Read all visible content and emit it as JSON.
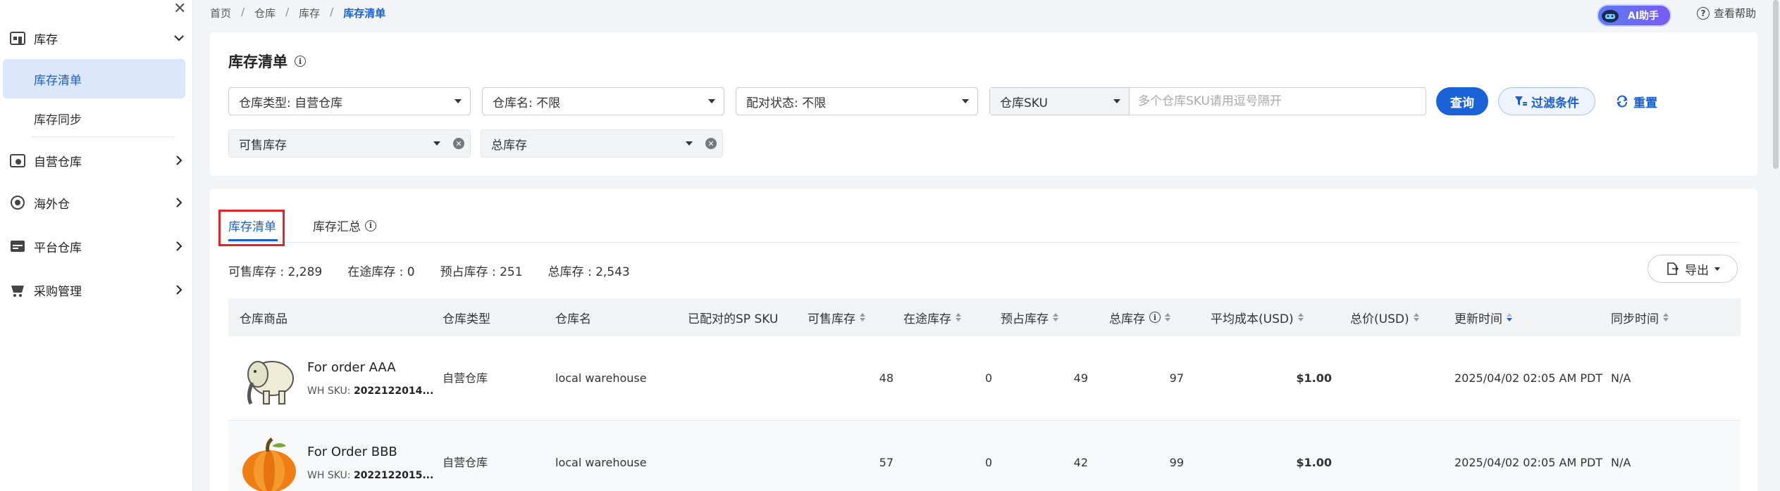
{
  "sidebar": {
    "groups": [
      {
        "label": "库存",
        "icon": "warehouse-icon"
      },
      {
        "label": "自营仓库",
        "icon": "own-warehouse-icon"
      },
      {
        "label": "海外仓",
        "icon": "overseas-warehouse-icon"
      },
      {
        "label": "平台仓库",
        "icon": "platform-warehouse-icon"
      },
      {
        "label": "采购管理",
        "icon": "purchase-icon"
      }
    ],
    "subitems": [
      {
        "label": "库存清单",
        "active": true
      },
      {
        "label": "库存同步",
        "active": false
      }
    ]
  },
  "breadcrumb": {
    "items": [
      "首页",
      "仓库",
      "库存",
      "库存清单"
    ],
    "sep": "/"
  },
  "topbar": {
    "ai_label": "AI助手",
    "help_label": "查看帮助"
  },
  "filters": {
    "title": "库存清单",
    "warehouse_type": "仓库类型: 自营仓库",
    "warehouse_name": "仓库名: 不限",
    "match_status": "配对状态: 不限",
    "sku_type": "仓库SKU",
    "sku_placeholder": "多个仓库SKU请用逗号隔开",
    "query_label": "查询",
    "filter_label": "过滤条件",
    "reset_label": "重置",
    "extra1": "可售库存",
    "extra2": "总库存"
  },
  "tabs": [
    {
      "label": "库存清单",
      "active": true
    },
    {
      "label": "库存汇总",
      "active": false
    }
  ],
  "stats": {
    "available": "可售库存 : 2,289",
    "in_transit": "在途库存 : 0",
    "reserved": "预占库存 : 251",
    "total": "总库存 : 2,543"
  },
  "export_label": "导出",
  "table": {
    "headers": {
      "product": "仓库商品",
      "wh_type": "仓库类型",
      "wh_name": "仓库名",
      "matched": "已配对的SP SKU",
      "available": "可售库存",
      "in_transit": "在途库存",
      "reserved": "预占库存",
      "total": "总库存",
      "avg_cost": "平均成本(USD)",
      "total_price": "总价(USD)",
      "updated": "更新时间",
      "synced": "同步时间"
    },
    "rows": [
      {
        "name": "For order AAA",
        "sku_label": "WH SKU:",
        "sku": "2022122014...",
        "wh_type": "自营仓库",
        "wh_name": "local warehouse",
        "available": "48",
        "in_transit": "0",
        "reserved": "49",
        "total": "97",
        "avg_cost": "$1.00",
        "updated": "2025/04/02 02:05 AM PDT",
        "synced": "N/A",
        "image": "elephant-image"
      },
      {
        "name": "For Order BBB",
        "sku_label": "WH SKU:",
        "sku": "2022122015...",
        "wh_type": "自营仓库",
        "wh_name": "local warehouse",
        "available": "57",
        "in_transit": "0",
        "reserved": "42",
        "total": "99",
        "avg_cost": "$1.00",
        "updated": "2025/04/02 02:05 AM PDT",
        "synced": "N/A",
        "image": "pumpkin-image"
      }
    ]
  },
  "colors": {
    "accent": "#1a62d6",
    "active_bg": "#dbe6fa",
    "highlight_box": "#e0262c"
  }
}
